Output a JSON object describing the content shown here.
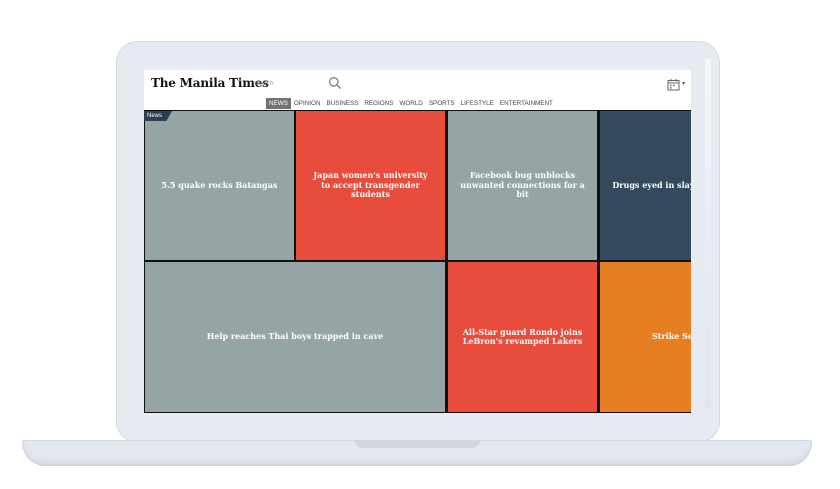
{
  "header": {
    "logo": "The Manila Times",
    "search_placeholder": "Search",
    "icons": [
      "search-icon",
      "calendar-icon",
      "chevron-down-icon"
    ]
  },
  "nav": {
    "items": [
      "NEWS",
      "OPINION",
      "BUSINESS",
      "REGIONS",
      "WORLD",
      "SPORTS",
      "LIFESTYLE",
      "ENTERTAINMENT"
    ],
    "active": "NEWS"
  },
  "section_tag": "News",
  "tiles": [
    {
      "headline": "5.5 quake rocks Batangas",
      "color": "#95a5a6"
    },
    {
      "headline": "Japan women's university to accept transgender students",
      "color": "#e74c3c"
    },
    {
      "headline": "Facebook bug unblocks unwanted connections for a bit",
      "color": "#95a5a6"
    },
    {
      "headline": "Drugs eyed in slay of mayor",
      "color": "#34495e"
    },
    {
      "headline": "Help reaches Thai boys trapped in cave",
      "color": "#95a5a6"
    },
    {
      "headline": "All-Star guard Rondo joins LeBron's revamped Lakers",
      "color": "#e74c3c"
    },
    {
      "headline": "Strike Ser",
      "color": "#e67e22"
    }
  ]
}
